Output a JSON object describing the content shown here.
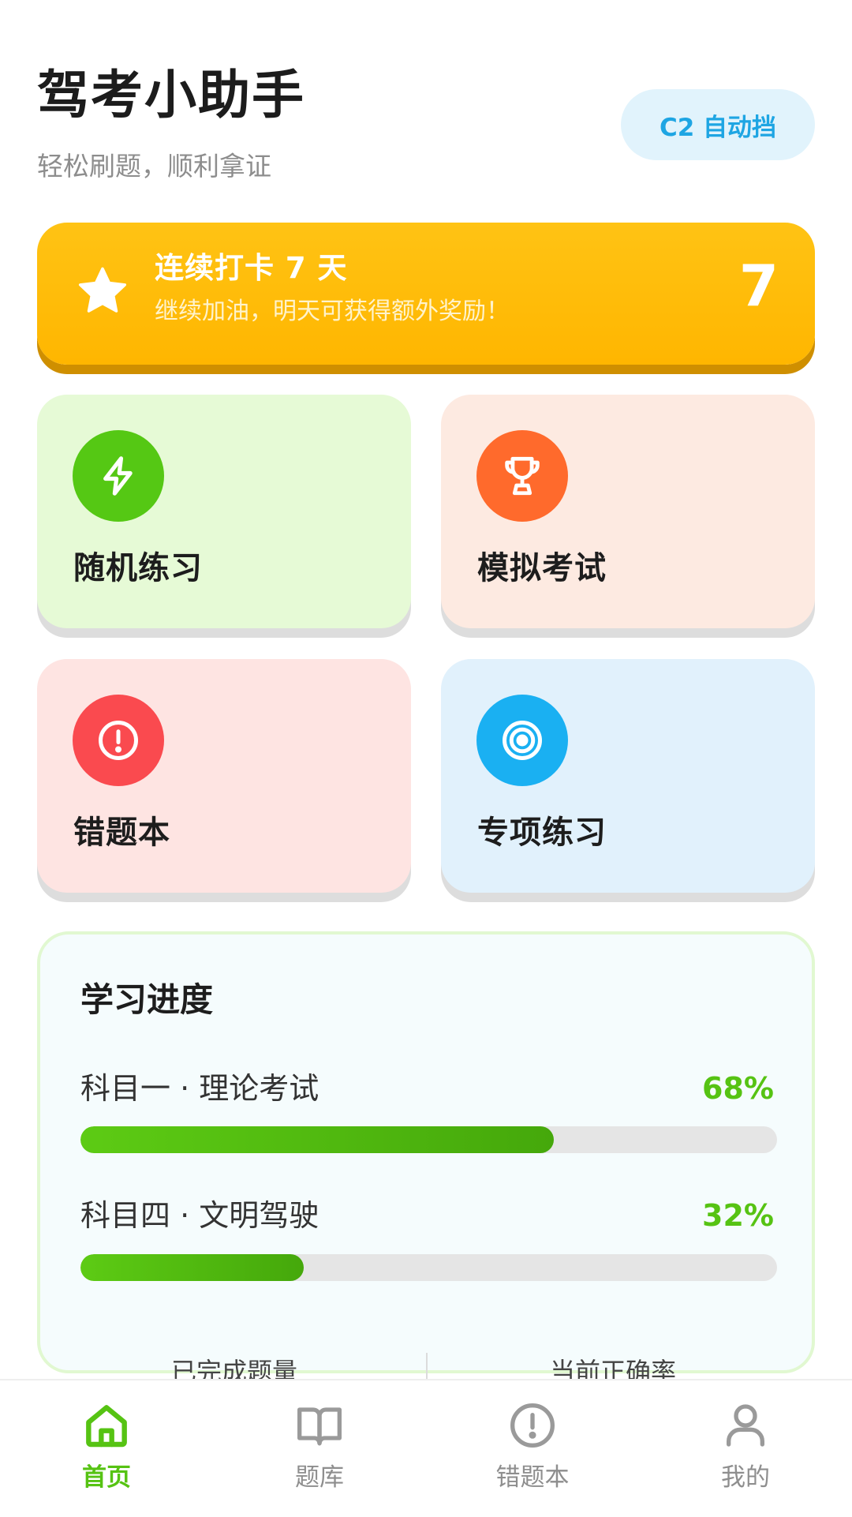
{
  "header": {
    "title": "驾考小助手",
    "subtitle": "轻松刷题，顺利拿证",
    "license_label": "C2 自动挡"
  },
  "streak": {
    "title": "连续打卡 7 天",
    "subtitle": "继续加油，明天可获得额外奖励！",
    "count": "7",
    "icon": "star-icon"
  },
  "cards": {
    "random": {
      "label": "随机练习",
      "icon": "lightning-icon",
      "color": "#55c814"
    },
    "exam": {
      "label": "模拟考试",
      "icon": "trophy-icon",
      "color": "#ff6a2c"
    },
    "wrong": {
      "label": "错题本",
      "icon": "alert-icon",
      "color": "#fa4a4f"
    },
    "special": {
      "label": "专项练习",
      "icon": "target-icon",
      "color": "#1ab0f2"
    }
  },
  "progress": {
    "title": "学习进度",
    "items": [
      {
        "label": "科目一 · 理论考试",
        "percent_text": "68%",
        "value": 0.68
      },
      {
        "label": "科目四 · 文明驾驶",
        "percent_text": "32%",
        "value": 0.32
      }
    ],
    "stats": {
      "completed_label": "已完成题量",
      "accuracy_label": "当前正确率"
    }
  },
  "tabs": [
    {
      "label": "首页",
      "icon": "home-icon",
      "active": true
    },
    {
      "label": "题库",
      "icon": "book-icon",
      "active": false
    },
    {
      "label": "错题本",
      "icon": "alert-icon",
      "active": false
    },
    {
      "label": "我的",
      "icon": "user-icon",
      "active": false
    }
  ],
  "colors": {
    "accent": "#56c313",
    "streak": "#ffbc0a",
    "license_pill": "#1ea5e3"
  }
}
